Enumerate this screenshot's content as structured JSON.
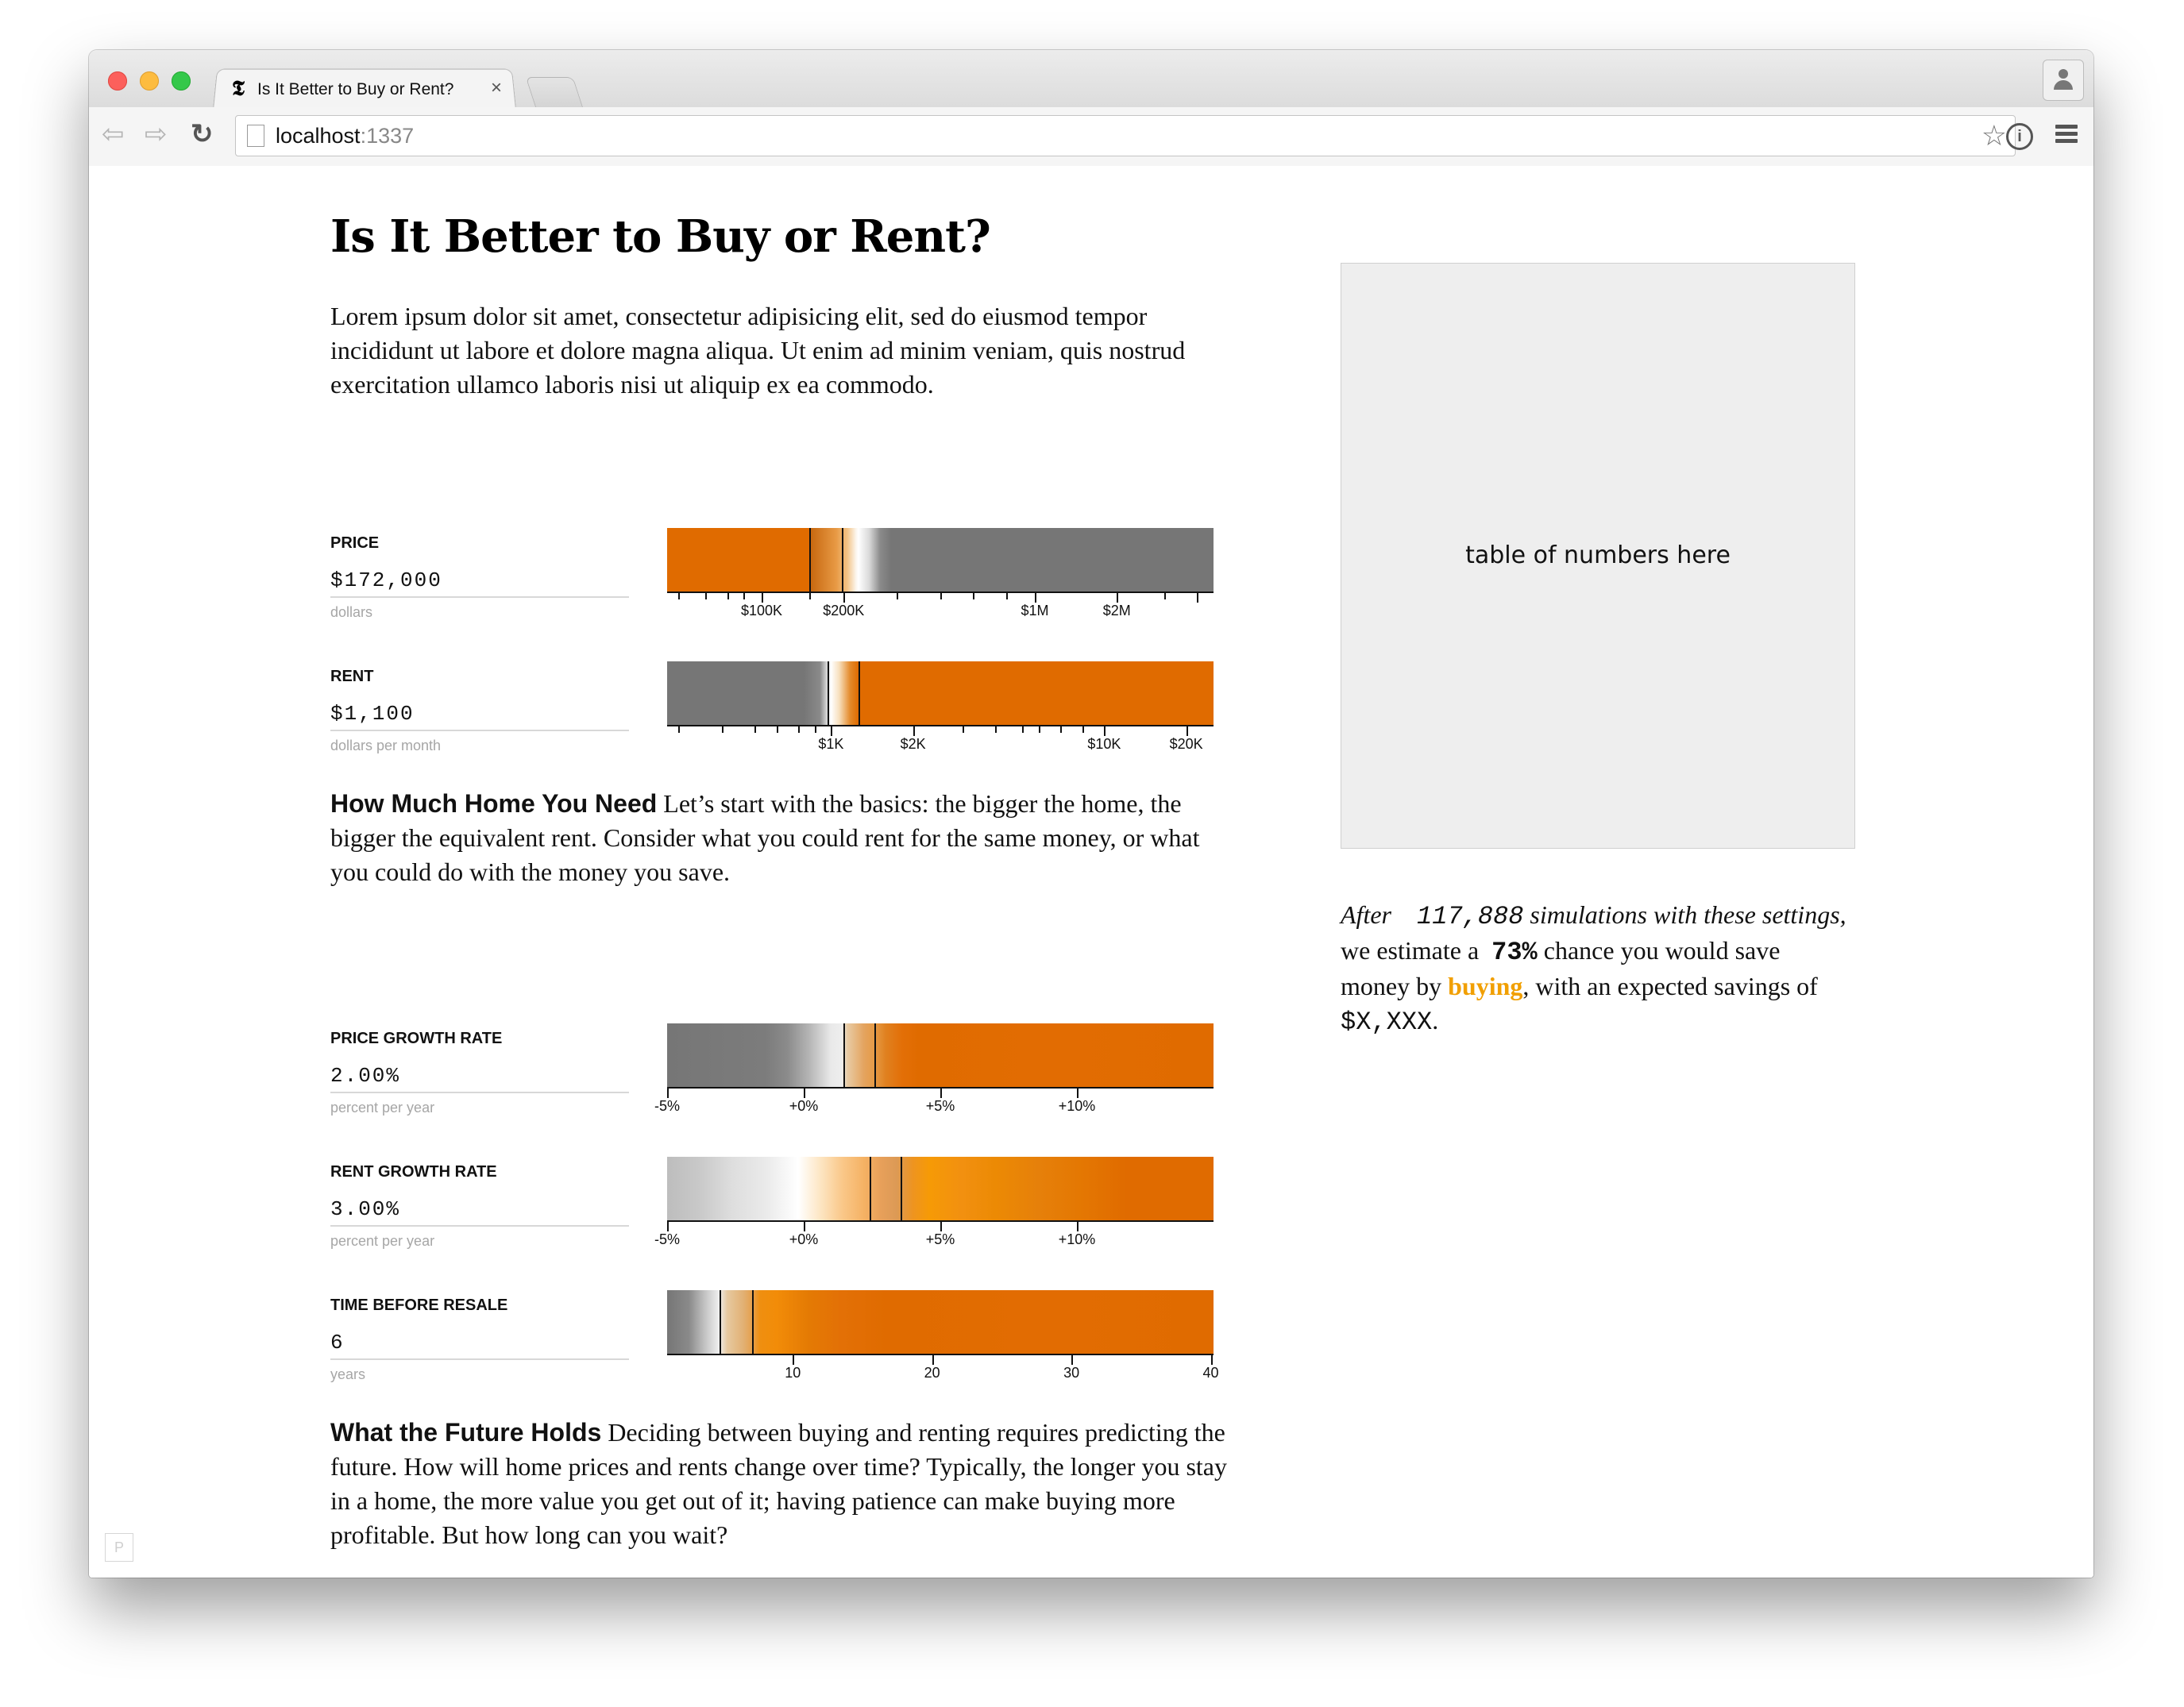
{
  "browser": {
    "tab_title": "Is It Better to Buy or Rent?",
    "tab_close": "×",
    "url_host": "localhost",
    "url_port": ":1337"
  },
  "page": {
    "title": "Is It Better to Buy or Rent?",
    "intro": "Lorem ipsum dolor sit amet, consectetur adipisicing elit, sed do eiusmod tempor incididunt ut labore et dolore magna aliqua. Ut enim ad minim veniam, quis nostrud exercitation ullamco laboris nisi ut aliquip ex ea commodo.",
    "home_heading": "How Much Home You Need",
    "home_text": " Let’s start with the basics: the bigger the home, the bigger the equivalent rent. Consider what you could rent for the same money, or what you could do with the money you save.",
    "future_heading": "What the Future Holds",
    "future_text": " Deciding between buying and renting requires predicting the future. How will home prices and rents change over time? Typically, the longer you stay in a home, the more value you get out of it; having patience can make buying more profitable. But how long can you wait?",
    "corner_badge": "P"
  },
  "controls": {
    "price": {
      "label": "PRICE",
      "value": "$172,000",
      "unit": "dollars",
      "ticks": [
        "$100K",
        "$200K",
        "$1M",
        "$2M"
      ]
    },
    "rent": {
      "label": "RENT",
      "value": "$1,100",
      "unit": "dollars per month",
      "ticks": [
        "$1K",
        "$2K",
        "$10K",
        "$20K"
      ]
    },
    "price_growth": {
      "label": "PRICE GROWTH RATE",
      "value": "2.00%",
      "unit": "percent per year",
      "ticks": [
        "-5%",
        "+0%",
        "+5%",
        "+10%"
      ]
    },
    "rent_growth": {
      "label": "RENT GROWTH RATE",
      "value": "3.00%",
      "unit": "percent per year",
      "ticks": [
        "-5%",
        "+0%",
        "+5%",
        "+10%"
      ]
    },
    "resale": {
      "label": "TIME BEFORE RESALE",
      "value": "6",
      "unit": "years",
      "ticks": [
        "10",
        "20",
        "30",
        "40"
      ]
    }
  },
  "sidebar": {
    "table_placeholder": "table of numbers here",
    "after": "After",
    "simulations": "117,888",
    "sim_tail": " simulations with these settings,",
    "estimate": " we estimate a ",
    "percent": "73%",
    "chance": " chance you would save money by ",
    "buying": "buying",
    "with": ", with an expected savings of ",
    "savings": "$X,XXX",
    "period": "."
  },
  "colors": {
    "orange": "#e06b00",
    "gray": "#767676",
    "buying": "#f19f00"
  }
}
